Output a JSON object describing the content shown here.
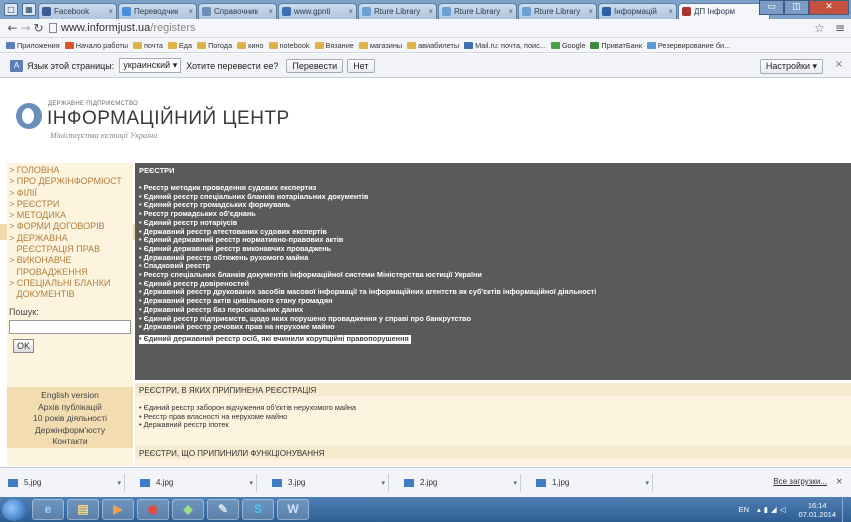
{
  "browser": {
    "tabs": [
      {
        "label": "Facebook",
        "color": "#3b5998"
      },
      {
        "label": "Переводчик",
        "color": "#4a90d9"
      },
      {
        "label": "Справочник",
        "color": "#6a8fb8"
      },
      {
        "label": "www.gpnti",
        "color": "#3a70b0"
      },
      {
        "label": "Rture Library",
        "color": "#6aa0d8"
      },
      {
        "label": "Rture Library",
        "color": "#6aa0d8"
      },
      {
        "label": "Rture Library",
        "color": "#6aa0d8"
      },
      {
        "label": "Інформацій",
        "color": "#2b5fa5"
      },
      {
        "label": "ДП Інформ",
        "color": "#a8362e",
        "active": true
      }
    ],
    "url_host": "www.informjust.ua",
    "url_path": "/registers",
    "bookmarks": [
      {
        "label": "Приложения",
        "color": "#5a7fb8"
      },
      {
        "label": "Начало работы",
        "color": "#d9532c"
      },
      {
        "label": "почта",
        "color": "#e0b24a"
      },
      {
        "label": "Еда",
        "color": "#e0b24a"
      },
      {
        "label": "Погода",
        "color": "#e0b24a"
      },
      {
        "label": "кино",
        "color": "#e0b24a"
      },
      {
        "label": "notebook",
        "color": "#e0b24a"
      },
      {
        "label": "Вязание",
        "color": "#e0b24a"
      },
      {
        "label": "магазины",
        "color": "#e0b24a"
      },
      {
        "label": "авиабилеты",
        "color": "#e0b24a"
      },
      {
        "label": "Mail.ru: почта, поис...",
        "color": "#3b6fb0"
      },
      {
        "label": "Google",
        "color": "#48a04a"
      },
      {
        "label": "ПриватБанк",
        "color": "#3d8a3d"
      },
      {
        "label": "Резервирование би...",
        "color": "#5a9ad9"
      }
    ],
    "translate": {
      "prefix": "Язык этой страницы:",
      "language": "украинский ▾",
      "question": "Хотите перевести ее?",
      "translate_btn": "Перевести",
      "no_btn": "Нет",
      "settings": "Настройки ▾"
    }
  },
  "site": {
    "logo_top": "ДЕРЖАВНЕ ПІДПРИЄМСТВО",
    "logo_title": "ІНФОРМАЦІЙНИЙ ЦЕНТР",
    "logo_sub": "Міністерства юстиції України",
    "nav": [
      "> ГОЛОВНА",
      "> ПРО ДЕРЖІНФОРМЮСТ",
      "> ФІЛІЇ",
      "> РЕЄСТРИ",
      "> МЕТОДИКА",
      "> ФОРМИ ДОГОВОРІВ",
      "> ДЕРЖАВНА\n   РЕЄСТРАЦІЯ ПРАВ",
      "> ВИКОНАВЧЕ\n   ПРОВАДЖЕННЯ",
      "> СПЕЦІАЛЬНІ БЛАНКИ\n   ДОКУМЕНТІВ"
    ],
    "search_label": "Пошук:",
    "ok_label": "OK",
    "side_links": [
      "English version",
      "Архів публікацій",
      "10 років діяльності",
      "Держінформ'юсту",
      "Контакти"
    ],
    "registers_title": "РЕЄСТРИ",
    "registers": [
      "Реєстр методик проведення судових експертиз",
      "Єдиний реєстр спеціальних бланків нотаріальних документів",
      "Єдиний реєстр громадських формувань",
      "Реєстр громадських об'єднань",
      "Єдиний реєстр нотаріусів",
      "Державний реєстр атестованих судових експертів",
      "Єдиний державний реєстр нормативно-правових актів",
      "Єдиний державний реєстр виконавчих проваджень",
      "Державний реєстр обтяжень рухомого майна",
      "Спадковий реєстр",
      "Реєстр спеціальних бланків документів інформаційної системи Міністерства юстиції України",
      "Єдиний реєстр довіреностей",
      "Державний реєстр друкованих засобів масової інформації та інформаційних агентств як суб'єктів інформаційної діяльності",
      "Державний реєстр актів цивільного стану громадян",
      "Державний реєстр баз персональних даних",
      "Єдиний реєстр підприємств, щодо яких порушено провадження у справі про банкрутство",
      "Державний реєстр речових прав на нерухоме майно",
      "Єдиний державний реєстр осіб, які вчинили корупційні правопорушення"
    ],
    "stopped_title": "РЕЄСТРИ, В ЯКИХ ПРИПИНЕНА РЕЄСТРАЦІЯ",
    "stopped": [
      "Єдиний реєстр заборон відчуження об'єктів нерухомого майна",
      "Реєстр прав власності на нерухоме майно",
      "Державний реєстр іпотек"
    ],
    "ceased_title": "РЕЄСТРИ, ЩО ПРИПИНИЛИ ФУНКЦІОНУВАННЯ"
  },
  "downloads": {
    "files": [
      "5.jpg",
      "4.jpg",
      "3.jpg",
      "2.jpg",
      "1.jpg"
    ],
    "all_label": "Все загрузки..."
  },
  "taskbar": {
    "lang": "EN",
    "time": "16:14",
    "date": "07.01.2014"
  }
}
